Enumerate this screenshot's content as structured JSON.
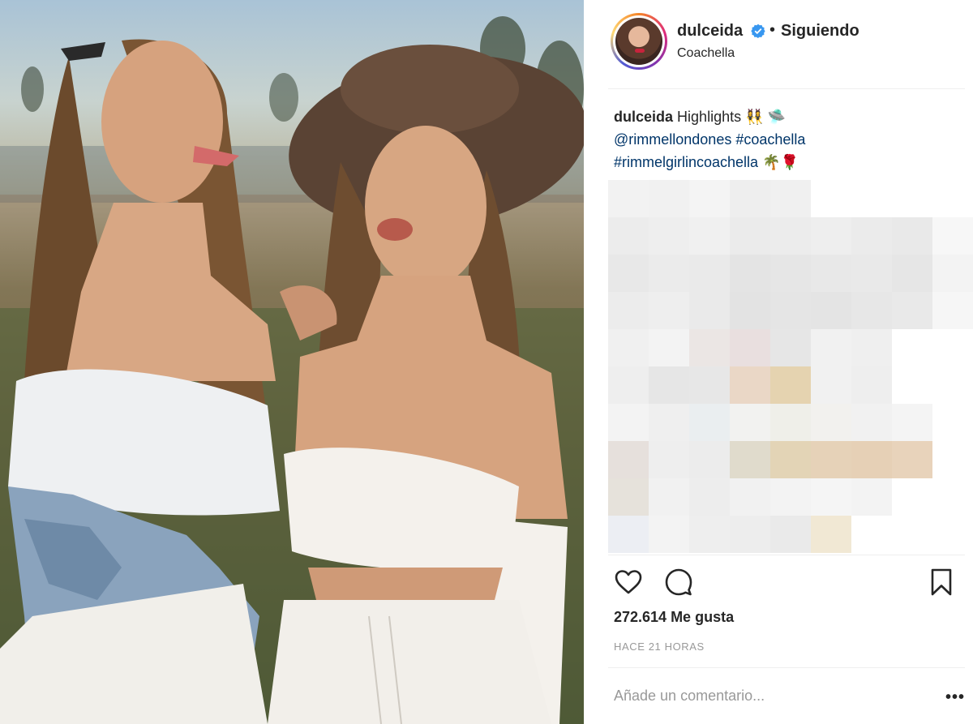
{
  "post": {
    "username": "dulceida",
    "follow_status": "Siguiendo",
    "separator": "•",
    "location": "Coachella",
    "caption": {
      "username": "dulceida",
      "text": "Highlights",
      "emoji_1": "👯‍♀️",
      "emoji_2": "🛸",
      "mention": "@rimmellondones",
      "hashtag_1": "#coachella",
      "hashtag_2": "#rimmelgirlincoachella",
      "emoji_3": "🌴",
      "emoji_4": "🌹"
    },
    "likes": "272.614 Me gusta",
    "time": "HACE 21 HORAS",
    "comment_placeholder": "Añade un comentario...",
    "more_options": "•••"
  },
  "icons": {
    "verified": "verified-badge-icon",
    "like": "heart-icon",
    "comment": "comment-icon",
    "save": "bookmark-icon"
  },
  "colors": {
    "link": "#003569",
    "verified": "#3897f0",
    "text": "#262626",
    "muted": "#999999"
  }
}
